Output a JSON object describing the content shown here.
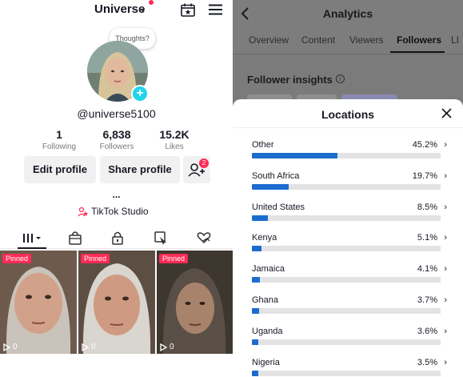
{
  "profile": {
    "title": "Universe",
    "thoughts_bubble": "Thoughts?",
    "handle": "@universe5100",
    "stats": [
      {
        "value": "1",
        "label": "Following"
      },
      {
        "value": "6,838",
        "label": "Followers"
      },
      {
        "value": "15.2K",
        "label": "Likes"
      }
    ],
    "edit_profile_label": "Edit profile",
    "share_profile_label": "Share profile",
    "friend_requests_count": "2",
    "more_label": "...",
    "studio_label": "TikTok Studio",
    "videos": [
      {
        "badge": "Pinned",
        "views": "0"
      },
      {
        "badge": "Pinned",
        "views": "0"
      },
      {
        "badge": "Pinned",
        "views": "0"
      }
    ]
  },
  "analytics": {
    "title": "Analytics",
    "tabs": [
      "Overview",
      "Content",
      "Viewers",
      "Followers",
      "LI"
    ],
    "active_tab": "Followers",
    "section_title": "Follower insights",
    "sheet": {
      "title": "Locations",
      "locations": [
        {
          "name": "Other",
          "percent": "45.2%",
          "share": 45.2
        },
        {
          "name": "South Africa",
          "percent": "19.7%",
          "share": 19.7
        },
        {
          "name": "United States",
          "percent": "8.5%",
          "share": 8.5
        },
        {
          "name": "Kenya",
          "percent": "5.1%",
          "share": 5.1
        },
        {
          "name": "Jamaica",
          "percent": "4.1%",
          "share": 4.1
        },
        {
          "name": "Ghana",
          "percent": "3.7%",
          "share": 3.7
        },
        {
          "name": "Uganda",
          "percent": "3.6%",
          "share": 3.6
        },
        {
          "name": "Nigeria",
          "percent": "3.5%",
          "share": 3.5
        }
      ]
    }
  },
  "colors": {
    "accent_pink": "#fe2c55",
    "accent_cyan": "#20d5ec",
    "bar_blue": "#1c6ccf"
  },
  "icons": {
    "header": [
      "calendar-star-icon",
      "hamburger-menu-icon"
    ],
    "profile_tabs": [
      "grid-icon",
      "shop-bag-icon",
      "lock-icon",
      "tag-icon",
      "heart-hand-icon"
    ]
  }
}
